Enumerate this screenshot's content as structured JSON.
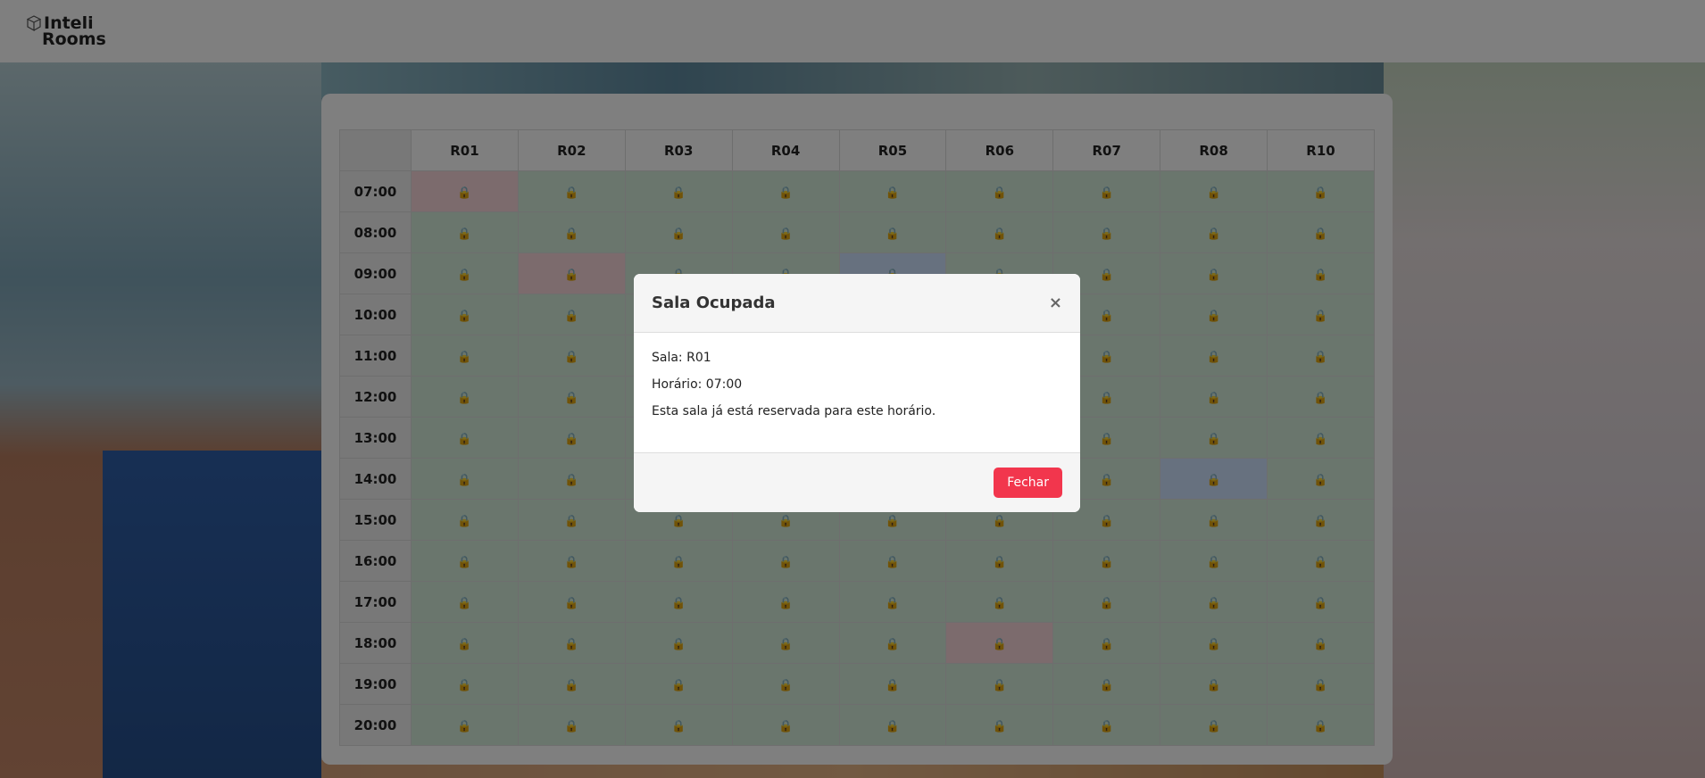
{
  "app": {
    "logo_line1": "Inteli",
    "logo_line2": "Rooms"
  },
  "colors": {
    "free": "#d4edda",
    "busy": "#f8d7da",
    "mine": "#cfe2ff",
    "close_button": "#f2364d"
  },
  "grid": {
    "lock_icon": "🔒",
    "rooms": [
      "R01",
      "R02",
      "R03",
      "R04",
      "R05",
      "R06",
      "R07",
      "R08",
      "R10"
    ],
    "times": [
      "07:00",
      "08:00",
      "09:00",
      "10:00",
      "11:00",
      "12:00",
      "13:00",
      "14:00",
      "15:00",
      "16:00",
      "17:00",
      "18:00",
      "19:00",
      "20:00"
    ],
    "status": [
      [
        "busy",
        "free",
        "free",
        "free",
        "free",
        "free",
        "free",
        "free",
        "free"
      ],
      [
        "free",
        "free",
        "free",
        "free",
        "free",
        "free",
        "free",
        "free",
        "free"
      ],
      [
        "free",
        "busy",
        "free",
        "free",
        "mine",
        "free",
        "free",
        "free",
        "free"
      ],
      [
        "free",
        "free",
        "free",
        "free",
        "free",
        "free",
        "free",
        "free",
        "free"
      ],
      [
        "free",
        "free",
        "free",
        "free",
        "free",
        "free",
        "free",
        "free",
        "free"
      ],
      [
        "free",
        "free",
        "free",
        "free",
        "free",
        "free",
        "free",
        "free",
        "free"
      ],
      [
        "free",
        "free",
        "free",
        "free",
        "free",
        "free",
        "free",
        "free",
        "free"
      ],
      [
        "free",
        "free",
        "free",
        "free",
        "free",
        "free",
        "free",
        "mine",
        "free"
      ],
      [
        "free",
        "free",
        "free",
        "free",
        "free",
        "free",
        "free",
        "free",
        "free"
      ],
      [
        "free",
        "free",
        "free",
        "free",
        "free",
        "free",
        "free",
        "free",
        "free"
      ],
      [
        "free",
        "free",
        "free",
        "free",
        "free",
        "free",
        "free",
        "free",
        "free"
      ],
      [
        "free",
        "free",
        "free",
        "free",
        "free",
        "busy",
        "free",
        "free",
        "free"
      ],
      [
        "free",
        "free",
        "free",
        "free",
        "free",
        "free",
        "free",
        "free",
        "free"
      ],
      [
        "free",
        "free",
        "free",
        "free",
        "free",
        "free",
        "free",
        "free",
        "free"
      ]
    ]
  },
  "modal": {
    "title": "Sala Ocupada",
    "close_symbol": "×",
    "room_line": "Sala: R01",
    "time_line": "Horário: 07:00",
    "message": "Esta sala já está reservada para este horário.",
    "button_label": "Fechar"
  }
}
